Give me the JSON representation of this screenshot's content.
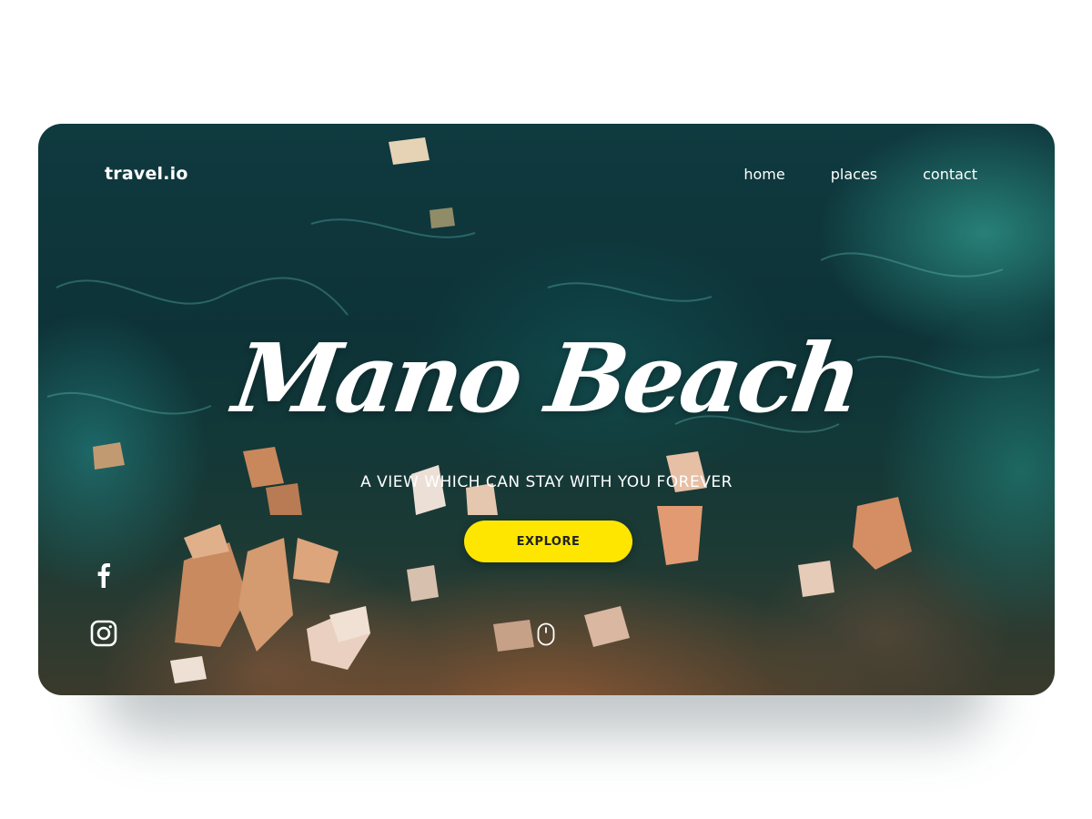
{
  "brand": {
    "logo_text": "travel.io"
  },
  "nav": {
    "items": [
      "home",
      "places",
      "contact"
    ]
  },
  "hero": {
    "headline": "Mano Beach",
    "tagline": "A VIEW WHICH CAN STAY WITH YOU FOREVER",
    "cta_label": "EXPLORE"
  },
  "social": {
    "icons": [
      "facebook-icon",
      "instagram-icon"
    ]
  },
  "scroll_hint": {
    "icon": "mouse-scroll-icon"
  },
  "colors": {
    "accent": "#ffe600",
    "text": "#ffffff",
    "water": "#0f3a3f"
  }
}
